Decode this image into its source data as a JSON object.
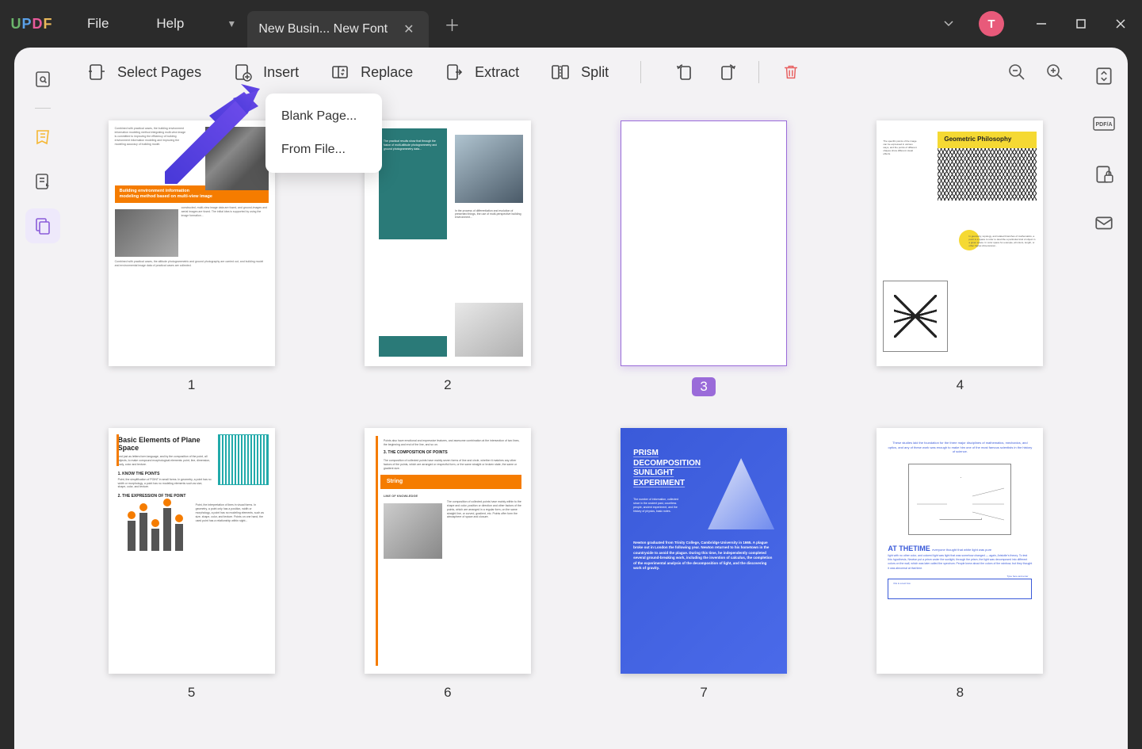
{
  "app": {
    "logo": "UPDF",
    "avatar_initial": "T"
  },
  "menu": {
    "file": "File",
    "help": "Help"
  },
  "tab": {
    "title": "New Busin... New Font"
  },
  "toolbar": {
    "select_pages": "Select Pages",
    "insert": "Insert",
    "replace": "Replace",
    "extract": "Extract",
    "split": "Split"
  },
  "insert_menu": {
    "blank": "Blank Page...",
    "from_file": "From File..."
  },
  "pages": {
    "p1": {
      "num": "1",
      "callout": "Building environment information modeling method based on multi-view image"
    },
    "p2": {
      "num": "2"
    },
    "p3": {
      "num": "3"
    },
    "p4": {
      "num": "4",
      "heading": "Geometric Philosophy"
    },
    "p5": {
      "num": "5",
      "title": "Basic Elements of Plane Space",
      "sub1": "1. KNOW THE POINTS",
      "sub2": "2. THE EXPRESSION OF THE POINT"
    },
    "p6": {
      "num": "6",
      "sub1": "3. THE COMPOSITION OF POINTS",
      "callout": "String",
      "sub2": "LINE OF KNOWLEDGE"
    },
    "p7": {
      "num": "7",
      "title": "PRISM DECOMPOSITION SUNLIGHT EXPERIMENT",
      "body": "Newton graduated from Trinity College, Cambridge University in 1665. A plague broke out in London the following year. Newton returned to his hometown in the countryside to avoid the plague. During this time, he independently completed several ground-breaking work, including the invention of calculus, the completion of the experimental analysis of the decomposition of light, and the discovering work of gravity."
    },
    "p8": {
      "num": "8",
      "top": "These studies laid the foundation for the three major disciplines of mathematics, mechanics, and optics, and any of these work was enough to make him one of the most famous scientists in the history of science.",
      "title": "AT THETIME",
      "box_tr": "Type here and enter",
      "box_bl": "this is a text box"
    }
  }
}
